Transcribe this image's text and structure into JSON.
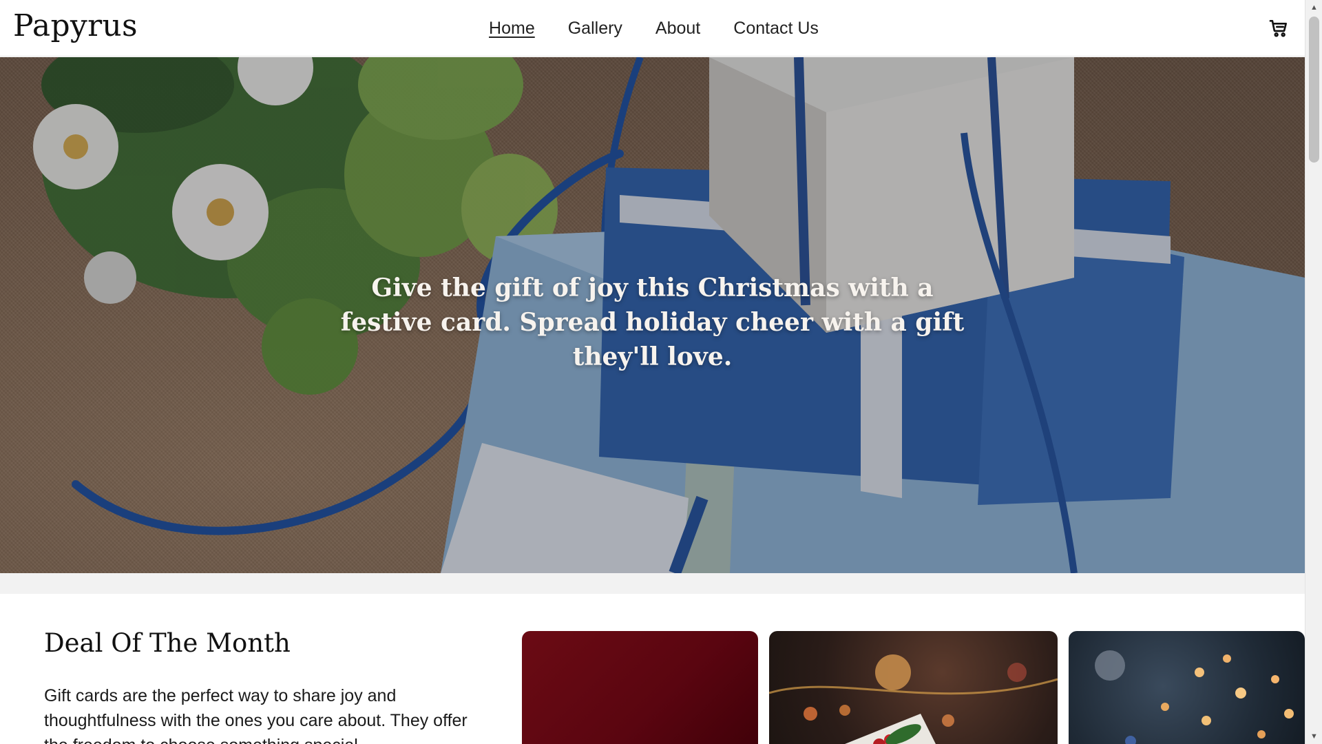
{
  "header": {
    "brand": "Papyrus",
    "nav": [
      {
        "label": "Home",
        "active": true
      },
      {
        "label": "Gallery",
        "active": false
      },
      {
        "label": "About",
        "active": false
      },
      {
        "label": "Contact Us",
        "active": false
      }
    ],
    "cart_icon": "cart-icon"
  },
  "hero": {
    "headline": "Give the gift of joy this Christmas with a festive card. Spread holiday cheer with a gift they'll love."
  },
  "deal": {
    "title": "Deal Of The Month",
    "text": "Gift cards are the perfect way to share joy and thoughtfulness with the ones you care about. They offer the freedom to choose something special"
  },
  "colors": {
    "hero_overlay": "#1c2536",
    "card_red": "#5a0510",
    "text": "#111111"
  }
}
